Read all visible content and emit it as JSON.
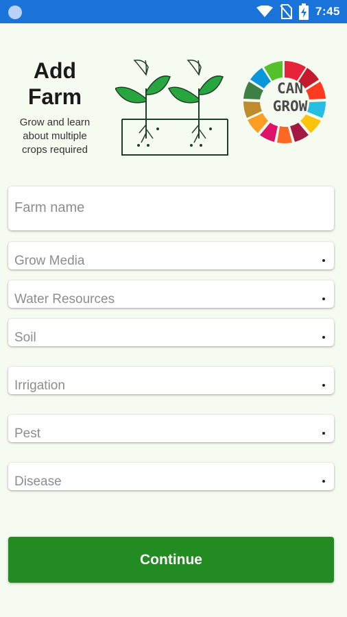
{
  "status_bar": {
    "time": "7:45",
    "icons": [
      "wifi-icon",
      "no-sim-icon",
      "battery-charging-icon"
    ],
    "color": "#1a73d8"
  },
  "header": {
    "title": "Add Farm",
    "subtitle": "Grow and learn about multiple crops required",
    "logo_text_top": "CAN",
    "logo_text_bottom": "GROW"
  },
  "form": {
    "farm_name_placeholder": "Farm name",
    "dropdowns": [
      {
        "label": "Grow Media"
      },
      {
        "label": "Water Resources"
      },
      {
        "label": "Soil"
      },
      {
        "label": "Irrigation"
      },
      {
        "label": "Pest"
      },
      {
        "label": "Disease"
      }
    ]
  },
  "actions": {
    "continue_label": "Continue",
    "continue_color": "#228b22"
  }
}
